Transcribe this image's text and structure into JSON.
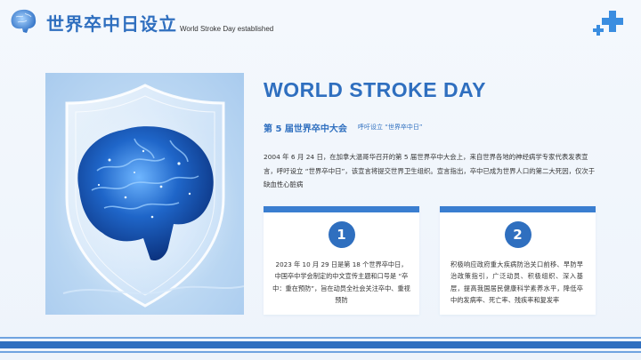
{
  "header": {
    "title_cn": "世界卒中日设立",
    "title_en": "World Stroke Day established"
  },
  "main": {
    "heading": "WORLD STROKE DAY",
    "subtitle": "第 5 届世界卒中大会",
    "subtitle_note": "呼吁设立 “世界卒中日”",
    "intro": "2004 年 6 月 24 日，在加拿大温哥华召开的第 5 届世界卒中大会上，来自世界各地的神经病学专家代表发表宣言，呼吁设立 “世界卒中日”，该宣言将提交世界卫生组织。宣言指出，卒中已成为世界人口的第二大死因，仅次于缺血性心脏病"
  },
  "cards": [
    {
      "number": "1",
      "text": "2023 年 10 月 29 日是第 18 个世界卒中日，中国卒中学会制定的中文宣传主题和口号是 “卒中：重在预防”，旨在动员全社会关注卒中、重视预防"
    },
    {
      "number": "2",
      "text": "积极响应政府重大疾病防治关口前移、早防早治政策指引，广泛动员、积极组织、深入基层，提高我国居民健康科学素养水平，降低卒中的发病率、死亡率、残疾率和复发率"
    }
  ],
  "icons": {
    "logo": "brain-icon",
    "corner": "medical-cross-icon",
    "image": "brain-shield-illustration"
  },
  "colors": {
    "primary": "#2f6fbf",
    "accent": "#3a7ed0",
    "background": "#f4f8fd"
  }
}
